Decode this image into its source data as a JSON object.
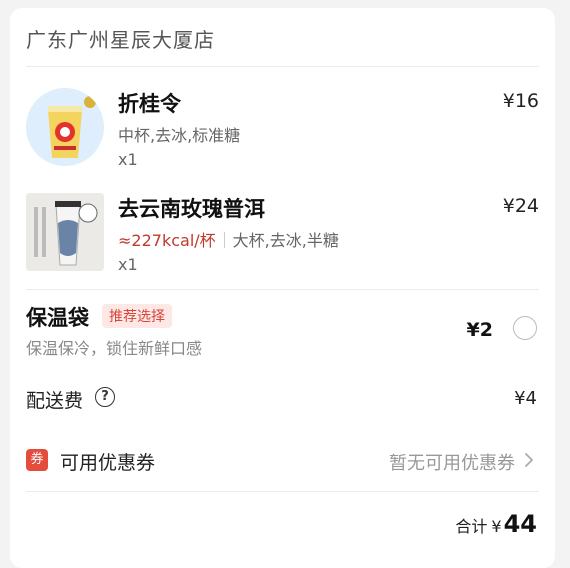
{
  "store": {
    "name": "广东广州星辰大厦店"
  },
  "items": [
    {
      "title": "折桂令",
      "price": "¥16",
      "spec": "中杯,去冰,标准糖",
      "qty": "x1"
    },
    {
      "title": "去云南玫瑰普洱",
      "price": "¥24",
      "kcal": "≈227kcal/杯",
      "spec": "大杯,去冰,半糖",
      "qty": "x1"
    }
  ],
  "bag": {
    "title": "保温袋",
    "badge": "推荐选择",
    "desc": "保温保冷，锁住新鲜口感",
    "price": "¥2",
    "selected": false
  },
  "delivery": {
    "label": "配送费",
    "price": "¥4"
  },
  "coupon": {
    "icon_text": "券",
    "label": "可用优惠券",
    "value": "暂无可用优惠券"
  },
  "total": {
    "label": "合计",
    "currency": "¥",
    "value": "44"
  },
  "icons": {
    "help": "question-circle-icon",
    "chevron": "chevron-right-icon"
  },
  "colors": {
    "accent_red": "#e44c3c",
    "kcal_red": "#c0392b",
    "badge_bg": "#fde8e6"
  }
}
